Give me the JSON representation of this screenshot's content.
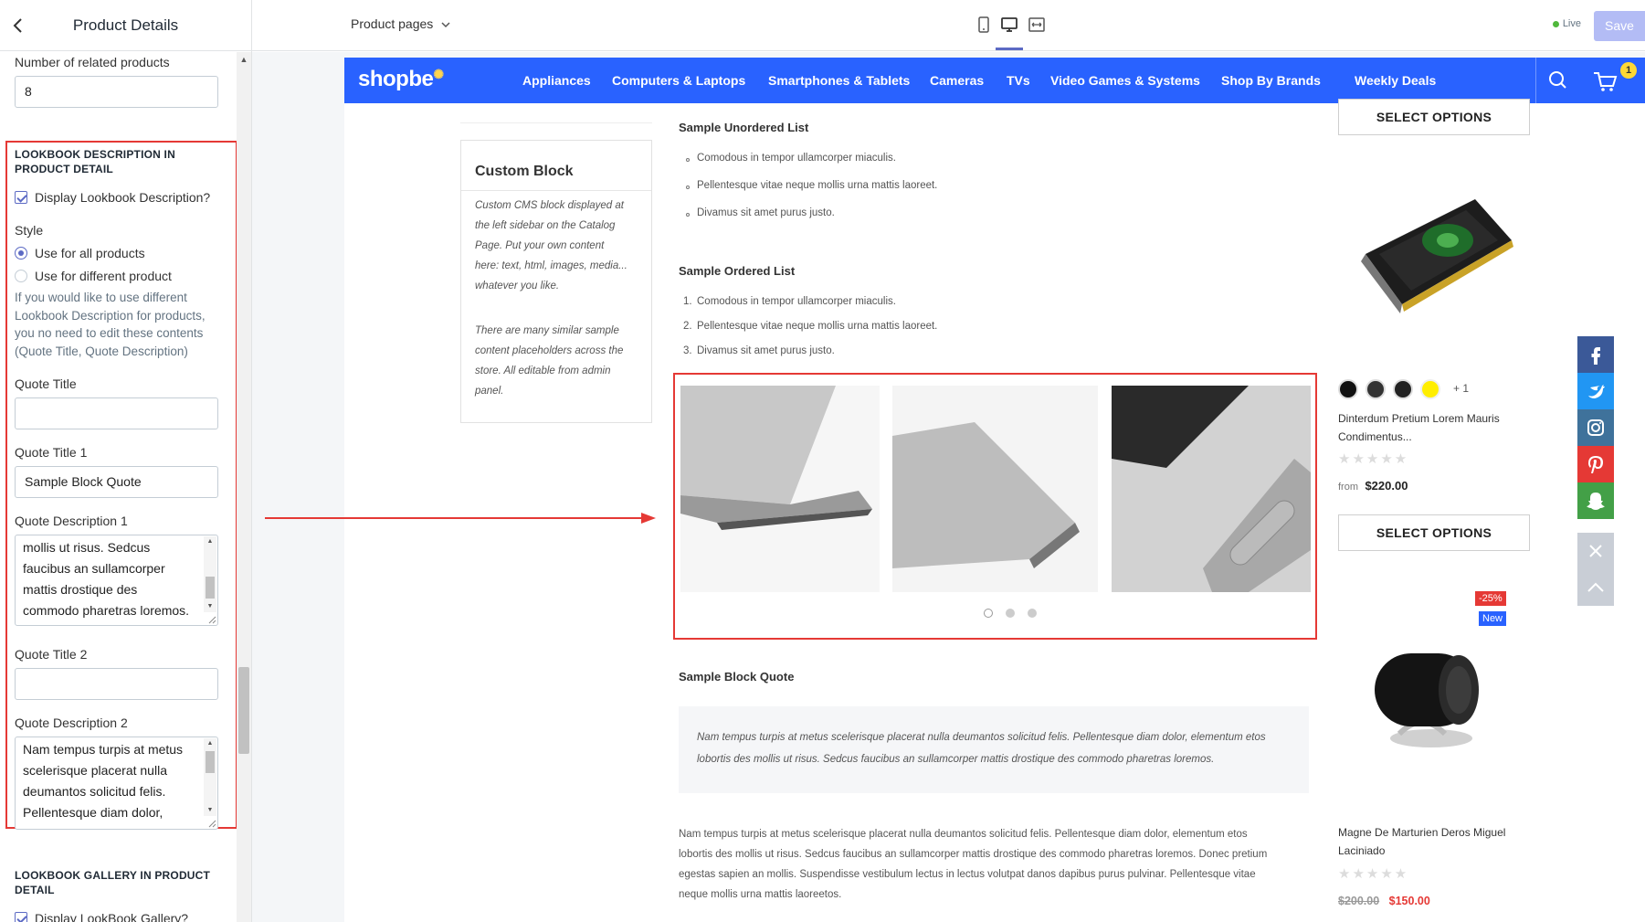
{
  "editor": {
    "title": "Product Details",
    "related_products": {
      "label": "Number of related products",
      "value": "8"
    },
    "lookbook_description": {
      "section_title": "LOOKBOOK DESCRIPTION IN PRODUCT DETAIL",
      "display_checkbox_label": "Display Lookbook Description?",
      "style_label": "Style",
      "style_options": [
        "Use for all products",
        "Use for different product"
      ],
      "style_selected": "Use for all products",
      "help_lines": [
        "If you would like to use different",
        "Lookbook Description for products,",
        "you no need to edit these contents",
        "(Quote Title, Quote Description)"
      ],
      "quote_title_label": "Quote Title",
      "quote_title_value": "",
      "quote_title_1_label": "Quote Title 1",
      "quote_title_1_value": "Sample Block Quote",
      "quote_description_1_label": "Quote Description 1",
      "quote_description_1_lines": [
        "mollis ut risus. Sedcus",
        "faucibus an sullamcorper",
        "mattis drostique des",
        "commodo pharetras loremos."
      ],
      "quote_title_2_label": "Quote Title 2",
      "quote_title_2_value": "",
      "quote_description_2_label": "Quote Description 2",
      "quote_description_2_lines": [
        "Nam tempus turpis at metus",
        "scelerisque placerat nulla",
        "deumantos solicitud felis.",
        "Pellentesque diam dolor,"
      ]
    },
    "lookbook_gallery": {
      "section_title": "LOOKBOOK GALLERY IN PRODUCT DETAIL",
      "display_checkbox_label": "Display LookBook Gallery?"
    }
  },
  "toolbar": {
    "page_select": "Product pages",
    "live_label": "Live",
    "save_label": "Save",
    "devices": [
      "mobile-icon",
      "desktop-icon",
      "fullwidth-icon"
    ],
    "active_device": "desktop-icon"
  },
  "store": {
    "logo": "shopbe",
    "nav": [
      "Appliances",
      "Computers & Laptops",
      "Smartphones & Tablets",
      "Cameras",
      "TVs",
      "Video Games & Systems",
      "Shop By Brands",
      "Weekly Deals"
    ],
    "cart_count": "1",
    "brand_color": "#2962ff"
  },
  "custom_block": {
    "title": "Custom Block",
    "paragraph_1": [
      "Custom CMS block displayed at",
      "the left sidebar on the Catalog",
      "Page. Put your own content",
      "here: text, html, images, media...",
      "whatever you like."
    ],
    "paragraph_2": [
      "There are many similar sample",
      "content placeholders across the",
      "store. All editable from admin",
      "panel."
    ]
  },
  "content": {
    "unordered_title": "Sample Unordered List",
    "unordered_items": [
      "Comodous in tempor ullamcorper miaculis.",
      "Pellentesque vitae neque mollis urna mattis laoreet.",
      "Divamus sit amet purus justo."
    ],
    "ordered_title": "Sample Ordered List",
    "ordered_items": [
      "Comodous in tempor ullamcorper miaculis.",
      "Pellentesque vitae neque mollis urna mattis laoreet.",
      "Divamus sit amet purus justo."
    ],
    "ordered_numbers": [
      "1.",
      "2.",
      "3."
    ],
    "slider_active_dot": 0,
    "blockquote_title": "Sample Block Quote",
    "blockquote_lines": [
      "Nam tempus turpis at metus scelerisque placerat nulla deumantos solicitud felis. Pellentesque diam dolor, elementum etos",
      "lobortis des mollis ut risus. Sedcus faucibus an sullamcorper mattis drostique des commodo pharetras loremos."
    ],
    "paragraph_lines": [
      "Nam tempus turpis at metus scelerisque placerat nulla deumantos solicitud felis. Pellentesque diam dolor, elementum etos",
      "lobortis des mollis ut risus. Sedcus faucibus an sullamcorper mattis drostique des commodo pharetras loremos. Donec pretium",
      "egestas sapien an mollis. Suspendisse vestibulum lectus in lectus volutpat danos dapibus purus pulvinar. Pellentesque vitae",
      "neque mollis urna mattis laoreetos."
    ]
  },
  "products": {
    "select_options_label": "SELECT OPTIONS",
    "product_1": {
      "name_lines": [
        "Dinterdum Pretium Lorem Mauris",
        "Condimentus..."
      ],
      "swatch_more": "+ 1",
      "price_prefix": "from",
      "price": "$220.00",
      "rating": 0
    },
    "product_2": {
      "badge_sale": "-25%",
      "badge_new": "New",
      "name_lines": [
        "Magne De Marturien Deros Miguel",
        "Laciniado"
      ],
      "old_price": "$200.00",
      "price": "$150.00",
      "rating": 0,
      "sale_color": "#e53935",
      "new_color": "#2962ff"
    }
  },
  "social": [
    "facebook-icon",
    "twitter-icon",
    "instagram-icon",
    "pinterest-icon",
    "snapchat-icon"
  ]
}
